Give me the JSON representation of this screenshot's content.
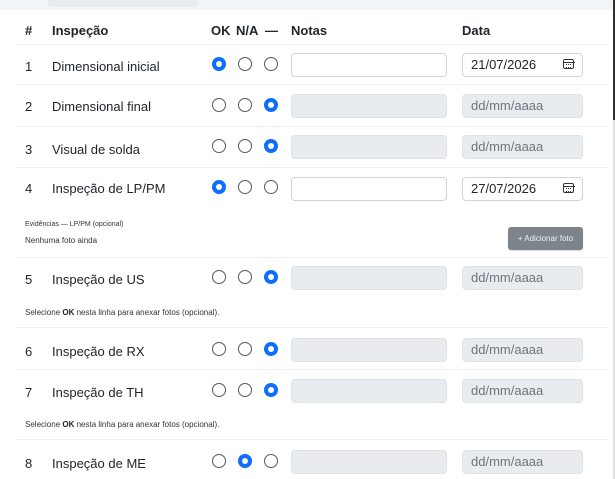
{
  "table": {
    "headers": {
      "num": "#",
      "inspection": "Inspeção",
      "ok": "OK",
      "na": "N/A",
      "none": "—",
      "notes": "Notas",
      "date": "Data"
    },
    "rows": [
      {
        "num": "1",
        "label": "Dimensional inicial",
        "selected": "ok",
        "notes": "",
        "date": "21/07/2026"
      },
      {
        "num": "2",
        "label": "Dimensional final",
        "selected": "none",
        "notes": "",
        "date": "dd/mm/aaaa"
      },
      {
        "num": "3",
        "label": "Visual de solda",
        "selected": "none",
        "notes": "",
        "date": "dd/mm/aaaa"
      },
      {
        "num": "4",
        "label": "Inspeção de LP/PM",
        "selected": "ok",
        "notes": "",
        "date": "27/07/2026"
      },
      {
        "num": "5",
        "label": "Inspeção de US",
        "selected": "none",
        "notes": "",
        "date": "dd/mm/aaaa"
      },
      {
        "num": "6",
        "label": "Inspeção de RX",
        "selected": "none",
        "notes": "",
        "date": "dd/mm/aaaa"
      },
      {
        "num": "7",
        "label": "Inspeção de TH",
        "selected": "none",
        "notes": "",
        "date": "dd/mm/aaaa"
      },
      {
        "num": "8",
        "label": "Inspeção de ME",
        "selected": "na",
        "notes": "",
        "date": "dd/mm/aaaa"
      }
    ]
  },
  "evidence": {
    "title": "Evidências — LP/PM (opcional)",
    "empty": "Nenhuma foto ainda",
    "add_button": "+ Adicionar foto"
  },
  "hints": {
    "prefix": "Selecione ",
    "ok_word": "OK",
    "suffix": " nesta linha para anexar fotos (opcional)."
  },
  "colors": {
    "accent": "#0d6efd",
    "disabled_bg": "#e9ecef",
    "button_bg": "#7d848b"
  }
}
